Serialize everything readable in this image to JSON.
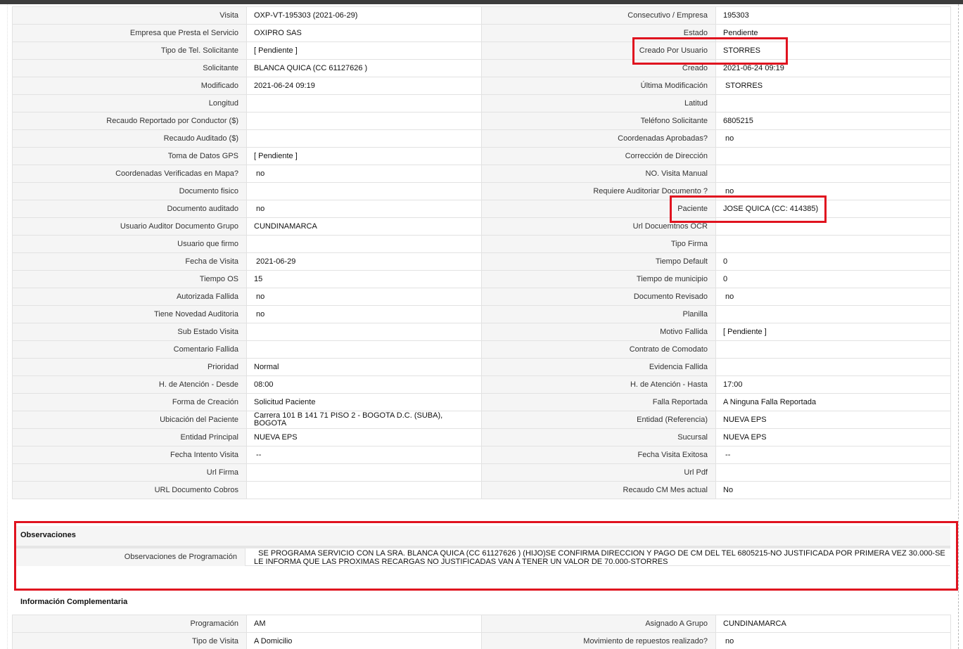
{
  "main_rows": [
    {
      "l1": "Visita",
      "v1": "OXP-VT-195303 (2021-06-29)",
      "l2": "Consecutivo / Empresa",
      "v2": "195303"
    },
    {
      "l1": "Empresa que Presta el Servicio",
      "v1": "OXIPRO SAS",
      "l2": "Estado",
      "v2": "Pendiente"
    },
    {
      "l1": "Tipo de Tel. Solicitante",
      "v1": "[ Pendiente ]",
      "l2": "Creado Por Usuario",
      "v2": "STORRES"
    },
    {
      "l1": "Solicitante",
      "v1": "BLANCA QUICA (CC 61127626 )",
      "l2": "Creado",
      "v2": "2021-06-24 09:19"
    },
    {
      "l1": "Modificado",
      "v1": "2021-06-24 09:19",
      "l2": "Última Modificación",
      "v2": " STORRES"
    },
    {
      "l1": "Longitud",
      "v1": "",
      "l2": "Latitud",
      "v2": ""
    },
    {
      "l1": "Recaudo Reportado por Conductor ($)",
      "v1": "",
      "l2": "Teléfono Solicitante",
      "v2": "6805215"
    },
    {
      "l1": "Recaudo Auditado ($)",
      "v1": "",
      "l2": "Coordenadas Aprobadas?",
      "v2": " no"
    },
    {
      "l1": "Toma de Datos GPS",
      "v1": "[ Pendiente ]",
      "l2": "Corrección de Dirección",
      "v2": ""
    },
    {
      "l1": "Coordenadas Verificadas en Mapa?",
      "v1": " no",
      "l2": "NO. Visita Manual",
      "v2": ""
    },
    {
      "l1": "Documento fisico",
      "v1": "",
      "l2": "Requiere Auditoriar Documento ?",
      "v2": " no"
    },
    {
      "l1": "Documento auditado",
      "v1": " no",
      "l2": "Paciente",
      "v2": "JOSE QUICA (CC: 414385)"
    },
    {
      "l1": "Usuario Auditor Documento Grupo",
      "v1": "CUNDINAMARCA",
      "l2": "Url Docuemtnos OCR",
      "v2": ""
    },
    {
      "l1": "Usuario que firmo",
      "v1": "",
      "l2": "Tipo Firma",
      "v2": ""
    },
    {
      "l1": "Fecha de Visita",
      "v1": " 2021-06-29",
      "l2": "Tiempo Default",
      "v2": "0"
    },
    {
      "l1": "Tiempo OS",
      "v1": "15",
      "l2": "Tiempo de municipio",
      "v2": "0"
    },
    {
      "l1": "Autorizada Fallida",
      "v1": " no",
      "l2": "Documento Revisado",
      "v2": " no"
    },
    {
      "l1": "Tiene Novedad Auditoria",
      "v1": " no",
      "l2": "Planilla",
      "v2": ""
    },
    {
      "l1": "Sub Estado Visita",
      "v1": "",
      "l2": "Motivo Fallida",
      "v2": "[ Pendiente ]"
    },
    {
      "l1": "Comentario Fallida",
      "v1": "",
      "l2": "Contrato de Comodato",
      "v2": ""
    },
    {
      "l1": "Prioridad",
      "v1": "Normal",
      "l2": "Evidencia Fallida",
      "v2": ""
    },
    {
      "l1": "H. de Atención - Desde",
      "v1": "08:00",
      "l2": "H. de Atención - Hasta",
      "v2": "17:00"
    },
    {
      "l1": "Forma de Creación",
      "v1": "Solicitud Paciente",
      "l2": "Falla Reportada",
      "v2": "A Ninguna Falla Reportada"
    },
    {
      "l1": "Ubicación del Paciente",
      "v1": "Carrera 101 B 141 71 PISO 2 - BOGOTA D.C. (SUBA), BOGOTA",
      "l2": "Entidad (Referencia)",
      "v2": "NUEVA EPS"
    },
    {
      "l1": "Entidad Principal",
      "v1": "NUEVA EPS",
      "l2": "Sucursal",
      "v2": "NUEVA EPS"
    },
    {
      "l1": "Fecha Intento Visita",
      "v1": " --",
      "l2": "Fecha Visita Exitosa",
      "v2": " --"
    },
    {
      "l1": "Url Firma",
      "v1": "",
      "l2": "Url Pdf",
      "v2": ""
    },
    {
      "l1": "URL Documento Cobros",
      "v1": "",
      "l2": "Recaudo CM Mes actual",
      "v2": "No"
    }
  ],
  "observaciones": {
    "title": "Observaciones",
    "label": "Observaciones de Programación",
    "value": "  SE PROGRAMA SERVICIO CON LA SRA. BLANCA QUICA (CC 61127626 ) (HIJO)SE CONFIRMA DIRECCION Y PAGO DE CM DEL TEL 6805215-NO JUSTIFICADA POR PRIMERA VEZ 30.000-SE LE INFORMA QUE LAS PROXIMAS RECARGAS NO JUSTIFICADAS VAN A TENER UN VALOR DE 70.000-STORRES"
  },
  "info_complementaria": {
    "title": "Información Complementaria",
    "rows": [
      {
        "l1": "Programación",
        "v1": "AM",
        "l2": "Asignado A Grupo",
        "v2": "CUNDINAMARCA"
      },
      {
        "l1": "Tipo de Visita",
        "v1": "A Domicilio",
        "l2": "Movimiento de repuestos realizado?",
        "v2": " no"
      }
    ]
  },
  "highlight_color": "#e0131f"
}
